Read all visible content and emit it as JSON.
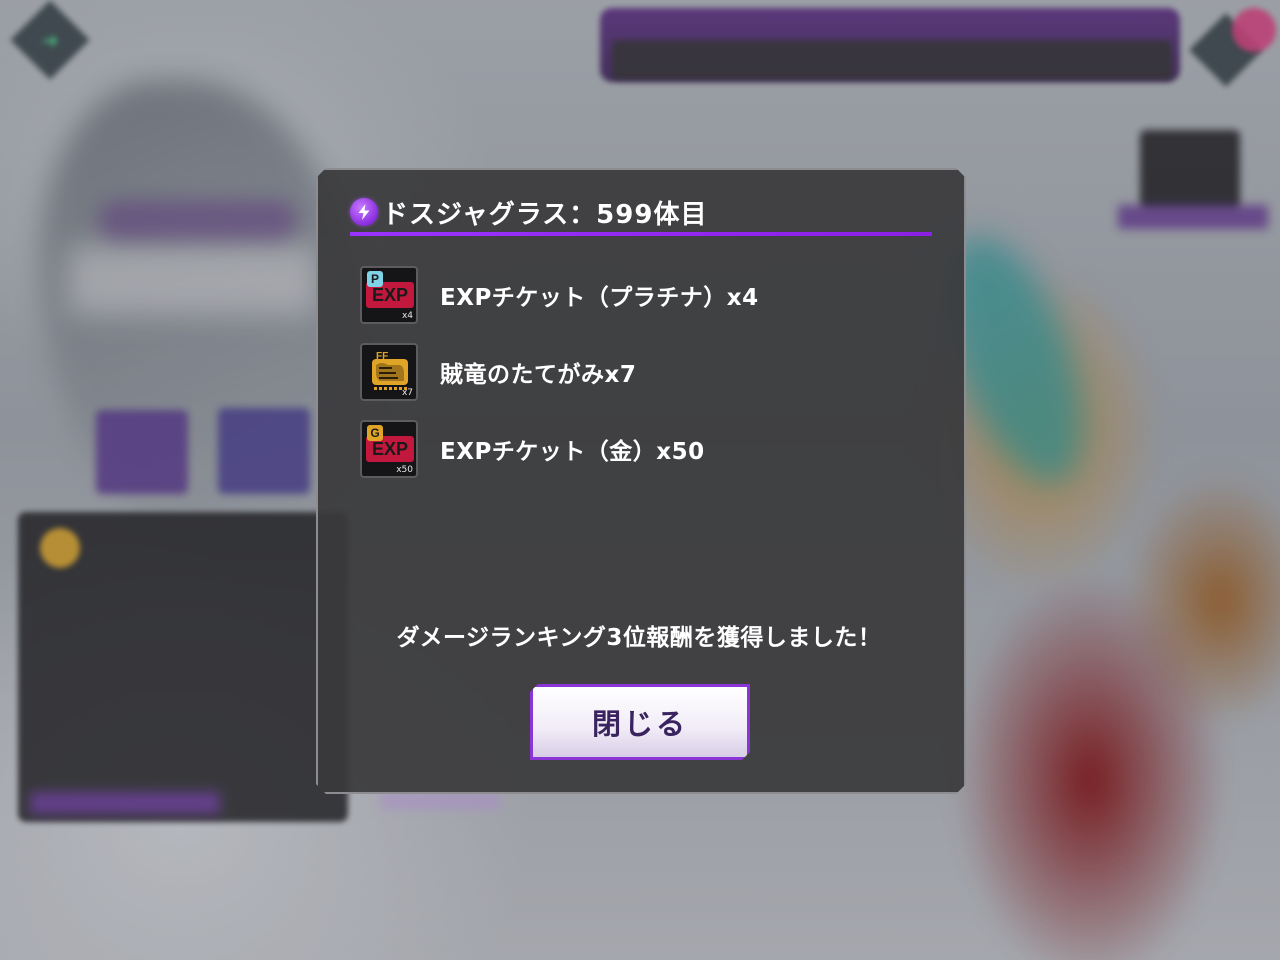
{
  "dialog": {
    "title": "ドスジャグラス：599体目",
    "message": "ダメージランキング3位報酬を獲得しました！",
    "close_label": "閉じる"
  },
  "rewards": [
    {
      "name": "EXPチケット（プラチナ）x4",
      "icon": "exp-ticket-platinum-icon",
      "badge": "P",
      "icon_text": "EXP",
      "quantity": "x4"
    },
    {
      "name": "賊竜のたてがみx7",
      "icon": "mane-material-icon",
      "icon_text": "FF",
      "quantity": "x7"
    },
    {
      "name": "EXPチケット（金）x50",
      "icon": "exp-ticket-gold-icon",
      "badge": "G",
      "icon_text": "EXP",
      "quantity": "x50"
    }
  ],
  "colors": {
    "accent_purple": "#9b33ff",
    "exp_red": "#c2183e",
    "platinum_badge": "#7fd3e6",
    "gold_badge": "#e0a526"
  }
}
